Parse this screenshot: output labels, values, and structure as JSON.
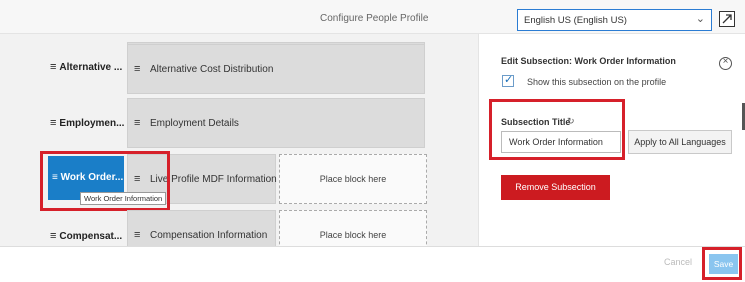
{
  "header": {
    "title": "Configure People Profile",
    "language_selected": "English US (English US)"
  },
  "subsections": [
    {
      "label": "Alternative ...",
      "blocks": [
        "Alternative Cost Distribution"
      ]
    },
    {
      "label": "Employmen...",
      "blocks": [
        "Employment Details"
      ]
    },
    {
      "label": "Work Order...",
      "blocks": [
        "Live Profile MDF Information"
      ],
      "placeholder": "Place block here",
      "tooltip": "Work Order Information",
      "selected": true
    },
    {
      "label": "Compensat...",
      "blocks": [
        "Compensation Information"
      ],
      "placeholder": "Place block here"
    }
  ],
  "panel": {
    "heading": "Edit Subsection: Work Order Information",
    "show_checkbox_label": "Show this subsection on the profile",
    "show_checked": true,
    "subsection_title_label": "Subsection Title",
    "subsection_title_value": "Work Order Information",
    "apply_all_label": "Apply to All Languages",
    "remove_label": "Remove Subsection"
  },
  "footer": {
    "cancel_label": "Cancel",
    "save_label": "Save"
  },
  "colors": {
    "accent": "#1a7ec8",
    "danger": "#cc1b20",
    "highlight": "#d6202a"
  }
}
